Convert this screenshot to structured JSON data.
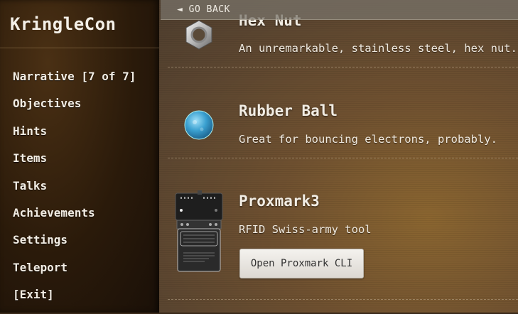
{
  "app": {
    "title": "KringleCon"
  },
  "nav": {
    "items": [
      {
        "label": "Narrative [7 of 7]"
      },
      {
        "label": "Objectives"
      },
      {
        "label": "Hints"
      },
      {
        "label": "Items"
      },
      {
        "label": "Talks"
      },
      {
        "label": "Achievements"
      },
      {
        "label": "Settings"
      },
      {
        "label": "Teleport"
      },
      {
        "label": "[Exit]"
      }
    ]
  },
  "header": {
    "back_label": "◄ GO BACK"
  },
  "items": [
    {
      "name": "Hex Nut",
      "description": "An unremarkable, stainless steel, hex nut.",
      "icon": "hex-nut-icon"
    },
    {
      "name": "Rubber Ball",
      "description": "Great for bouncing electrons, probably.",
      "icon": "rubber-ball-icon"
    },
    {
      "name": "Proxmark3",
      "description": "RFID Swiss-army tool",
      "icon": "proxmark-device-icon",
      "action_label": "Open Proxmark CLI"
    }
  ],
  "colors": {
    "text": "#f2ede4",
    "button_bg": "#eeebe6"
  }
}
